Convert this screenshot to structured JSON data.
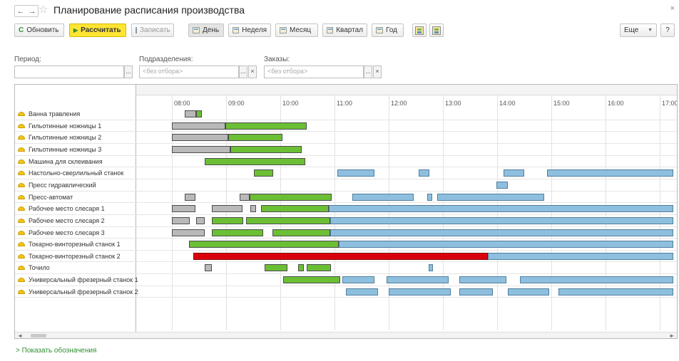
{
  "window": {
    "title": "Планирование расписания производства",
    "back_icon": "←",
    "forward_icon": "→",
    "close_icon": "×"
  },
  "toolbar": {
    "refresh": "Обновить",
    "calculate": "Рассчитать",
    "save": "Записать",
    "day": "День",
    "week": "Неделя",
    "month": "Месяц",
    "quarter": "Квартал",
    "year": "Год",
    "more": "Еще",
    "help": "?"
  },
  "filters": {
    "period_label": "Период:",
    "period_value": "",
    "divisions_label": "Подразделения:",
    "divisions_placeholder": "<без отбора>",
    "orders_label": "Заказы:",
    "orders_placeholder": "<без отбора>",
    "select_btn": "...",
    "clear_btn": "×"
  },
  "gantt": {
    "hours": [
      "08:00",
      "09:00",
      "10:00",
      "11:00",
      "12:00",
      "13:00",
      "14:00",
      "15:00",
      "16:00",
      "17:00"
    ],
    "resources": [
      "Ванна травления",
      "Гильотинные ножницы 1",
      "Гильотинные ножницы 2",
      "Гильотинные ножницы 3",
      "Машина для склеивания",
      "Настольно-сверлильный станок",
      "Пресс гидравлический",
      "Пресс-автомат",
      "Рабочее место слесаря 1",
      "Рабочее место слесаря 2",
      "Рабочее место слесаря 3",
      "Токарно-винторезный станок 1",
      "Токарно-винторезный станок 2",
      "Точило",
      "Универсальный фрезерный станок 1",
      "Универсальный фрезерный станок 2"
    ],
    "status_colors": {
      "done": "#b9b9b9",
      "in_progress": "#6bbf34",
      "planned": "#8fbfdf",
      "late": "#d9000d"
    },
    "tasks": [
      {
        "row": 0,
        "start": "08:14",
        "end": "08:27",
        "status": "done"
      },
      {
        "row": 0,
        "start": "08:27",
        "end": "08:33",
        "status": "in_progress"
      },
      {
        "row": 1,
        "start": "08:00",
        "end": "08:59",
        "status": "done"
      },
      {
        "row": 1,
        "start": "08:59",
        "end": "10:29",
        "status": "in_progress"
      },
      {
        "row": 2,
        "start": "08:00",
        "end": "09:02",
        "status": "done"
      },
      {
        "row": 2,
        "start": "09:02",
        "end": "10:02",
        "status": "in_progress"
      },
      {
        "row": 3,
        "start": "08:00",
        "end": "09:05",
        "status": "done"
      },
      {
        "row": 3,
        "start": "09:05",
        "end": "10:24",
        "status": "in_progress"
      },
      {
        "row": 4,
        "start": "08:36",
        "end": "10:28",
        "status": "in_progress"
      },
      {
        "row": 5,
        "start": "09:31",
        "end": "09:52",
        "status": "in_progress"
      },
      {
        "row": 5,
        "start": "11:03",
        "end": "11:44",
        "status": "planned"
      },
      {
        "row": 5,
        "start": "12:33",
        "end": "12:45",
        "status": "planned"
      },
      {
        "row": 5,
        "start": "14:07",
        "end": "14:30",
        "status": "planned"
      },
      {
        "row": 5,
        "start": "14:55",
        "end": "17:15",
        "status": "planned"
      },
      {
        "row": 6,
        "start": "13:59",
        "end": "14:12",
        "status": "planned"
      },
      {
        "row": 7,
        "start": "08:14",
        "end": "08:26",
        "status": "done"
      },
      {
        "row": 7,
        "start": "09:15",
        "end": "09:26",
        "status": "done"
      },
      {
        "row": 7,
        "start": "09:26",
        "end": "10:57",
        "status": "in_progress"
      },
      {
        "row": 7,
        "start": "11:20",
        "end": "12:28",
        "status": "planned"
      },
      {
        "row": 7,
        "start": "12:43",
        "end": "12:48",
        "status": "planned"
      },
      {
        "row": 7,
        "start": "12:54",
        "end": "14:52",
        "status": "planned"
      },
      {
        "row": 8,
        "start": "08:00",
        "end": "08:26",
        "status": "done"
      },
      {
        "row": 8,
        "start": "08:44",
        "end": "09:18",
        "status": "done"
      },
      {
        "row": 8,
        "start": "09:27",
        "end": "09:33",
        "status": "done"
      },
      {
        "row": 8,
        "start": "09:39",
        "end": "10:54",
        "status": "in_progress"
      },
      {
        "row": 8,
        "start": "10:54",
        "end": "17:15",
        "status": "planned"
      },
      {
        "row": 9,
        "start": "08:00",
        "end": "08:20",
        "status": "done"
      },
      {
        "row": 9,
        "start": "08:27",
        "end": "08:36",
        "status": "done"
      },
      {
        "row": 9,
        "start": "08:44",
        "end": "09:19",
        "status": "in_progress"
      },
      {
        "row": 9,
        "start": "09:22",
        "end": "10:55",
        "status": "in_progress"
      },
      {
        "row": 9,
        "start": "10:55",
        "end": "17:15",
        "status": "planned"
      },
      {
        "row": 10,
        "start": "08:00",
        "end": "08:36",
        "status": "done"
      },
      {
        "row": 10,
        "start": "08:44",
        "end": "09:41",
        "status": "in_progress"
      },
      {
        "row": 10,
        "start": "09:51",
        "end": "10:55",
        "status": "in_progress"
      },
      {
        "row": 10,
        "start": "10:55",
        "end": "17:15",
        "status": "planned"
      },
      {
        "row": 11,
        "start": "08:19",
        "end": "11:05",
        "status": "in_progress"
      },
      {
        "row": 11,
        "start": "11:05",
        "end": "17:15",
        "status": "planned"
      },
      {
        "row": 12,
        "start": "08:24",
        "end": "13:50",
        "status": "late"
      },
      {
        "row": 12,
        "start": "13:50",
        "end": "17:15",
        "status": "planned"
      },
      {
        "row": 13,
        "start": "08:36",
        "end": "08:44",
        "status": "done"
      },
      {
        "row": 13,
        "start": "09:43",
        "end": "10:08",
        "status": "in_progress"
      },
      {
        "row": 13,
        "start": "10:20",
        "end": "10:26",
        "status": "in_progress"
      },
      {
        "row": 13,
        "start": "10:29",
        "end": "10:56",
        "status": "in_progress"
      },
      {
        "row": 13,
        "start": "12:44",
        "end": "12:49",
        "status": "planned"
      },
      {
        "row": 14,
        "start": "10:03",
        "end": "11:06",
        "status": "in_progress"
      },
      {
        "row": 14,
        "start": "11:09",
        "end": "11:44",
        "status": "planned"
      },
      {
        "row": 14,
        "start": "11:58",
        "end": "13:06",
        "status": "planned"
      },
      {
        "row": 14,
        "start": "13:18",
        "end": "14:10",
        "status": "planned"
      },
      {
        "row": 14,
        "start": "14:25",
        "end": "17:15",
        "status": "planned"
      },
      {
        "row": 15,
        "start": "11:13",
        "end": "11:48",
        "status": "planned"
      },
      {
        "row": 15,
        "start": "12:00",
        "end": "13:09",
        "status": "planned"
      },
      {
        "row": 15,
        "start": "13:18",
        "end": "13:55",
        "status": "planned"
      },
      {
        "row": 15,
        "start": "14:12",
        "end": "14:58",
        "status": "planned"
      },
      {
        "row": 15,
        "start": "15:08",
        "end": "17:15",
        "status": "planned"
      }
    ]
  },
  "legend": {
    "label": "Показать обозначения"
  }
}
